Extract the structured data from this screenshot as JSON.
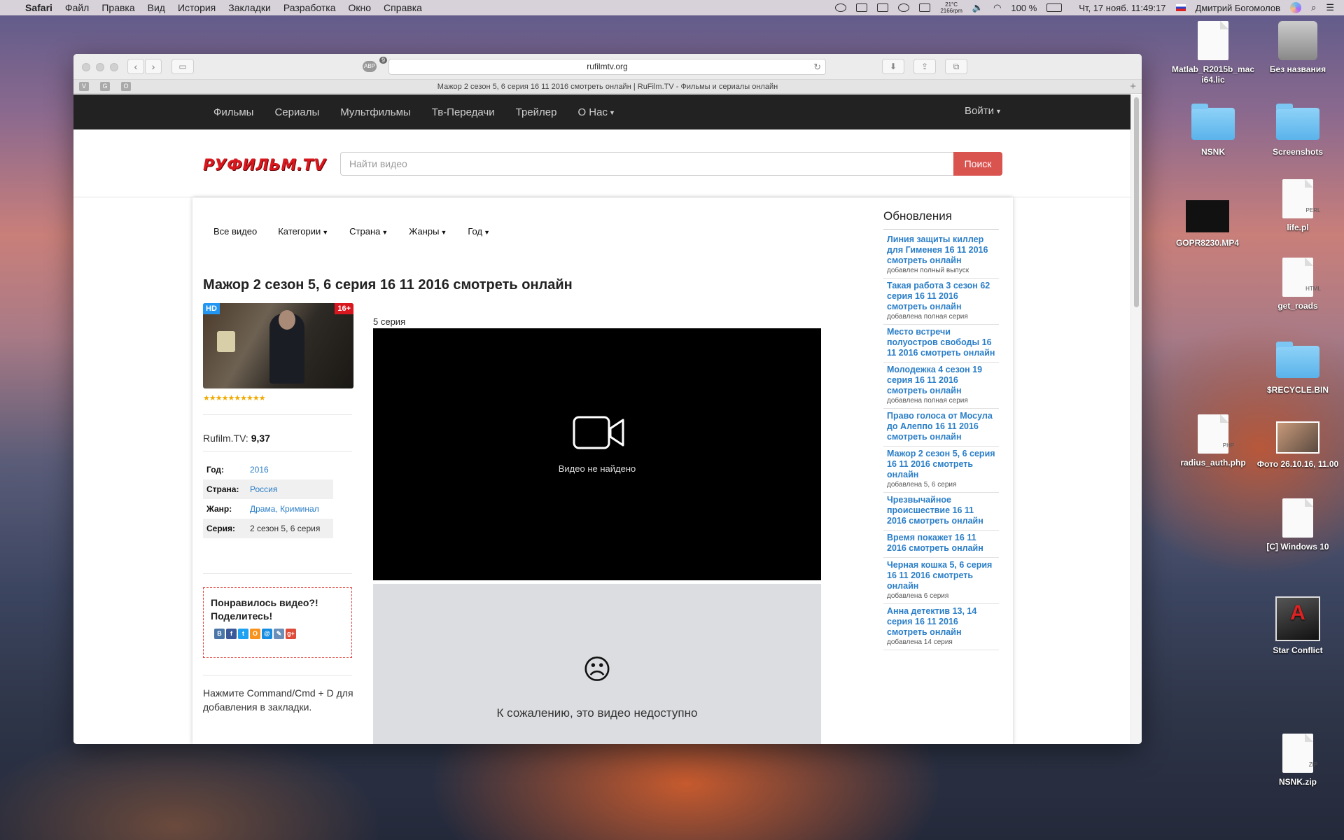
{
  "menubar": {
    "app": "Safari",
    "items": [
      "Файл",
      "Правка",
      "Вид",
      "История",
      "Закладки",
      "Разработка",
      "Окно",
      "Справка"
    ],
    "temp": "21°C",
    "rpm": "2166rpm",
    "battery": "100 %",
    "datetime": "Чт, 17 нояб.  11:49:17",
    "user": "Дмитрий Богомолов"
  },
  "browser": {
    "url": "rufilmtv.org",
    "tab_title": "Мажор 2 сезон 5, 6 серия 16 11 2016 смотреть онлайн | RuFilm.TV - Фильмы и сериалы онлайн",
    "abp_badge": "9",
    "favorites": [
      "V",
      "G",
      "O"
    ]
  },
  "site": {
    "nav": [
      "Фильмы",
      "Сериалы",
      "Мультфильмы",
      "Тв-Передачи",
      "Трейлер",
      "О Нас"
    ],
    "login": "Войти",
    "logo": "РУФИЛЬМ.TV",
    "search_placeholder": "Найти видео",
    "search_button": "Поиск",
    "subnav": [
      "Все видео",
      "Категории",
      "Страна",
      "Жанры",
      "Год"
    ],
    "title": "Мажор 2 сезон 5, 6 серия 16 11 2016 смотреть онлайн",
    "poster_badges": {
      "quality": "HD",
      "age": "16+"
    },
    "stars": "★★★★★★★★★★",
    "rating_label": "Rufilm.TV:",
    "rating_value": "9,37",
    "meta": [
      {
        "key": "Год:",
        "value": "2016"
      },
      {
        "key": "Страна:",
        "value": "Россия"
      },
      {
        "key": "Жанр:",
        "value": "Драма, Криминал"
      },
      {
        "key": "Серия:",
        "value": "2 сезон 5, 6 серия"
      }
    ],
    "share_title": "Понравилось видео?! Поделитесь!",
    "social": [
      "В",
      "f",
      "t",
      "O",
      "@",
      "✎",
      "g+"
    ],
    "bookmark_hint": "Нажмите Command/Cmd + D для добавления в закладки.",
    "episode_label": "5 серия",
    "player_message": "Видео не найдено",
    "sad_face": "☹",
    "unavailable_message": "К сожалению, это видео недоступно",
    "sidebar_title": "Обновления",
    "updates": [
      {
        "title": "Линия защиты киллер для Гименея 16 11 2016 смотреть онлайн",
        "note": "добавлен полный выпуск"
      },
      {
        "title": "Такая работа 3 сезон 62 серия 16 11 2016 смотреть онлайн",
        "note": "добавлена полная серия"
      },
      {
        "title": "Место встречи полуостров свободы 16 11 2016 смотреть онлайн",
        "note": ""
      },
      {
        "title": "Молодежка 4 сезон 19 серия 16 11 2016 смотреть онлайн",
        "note": "добавлена полная серия"
      },
      {
        "title": "Право голоса от Мосула до Алеппо 16 11 2016 смотреть онлайн",
        "note": ""
      },
      {
        "title": "Мажор 2 сезон 5, 6 серия 16 11 2016 смотреть онлайн",
        "note": "добавлена 5, 6 серия"
      },
      {
        "title": "Чрезвычайное происшествие 16 11 2016 смотреть онлайн",
        "note": ""
      },
      {
        "title": "Время покажет 16 11 2016 смотреть онлайн",
        "note": ""
      },
      {
        "title": "Черная кошка 5, 6 серия 16 11 2016 смотреть онлайн",
        "note": "добавлена 6 серия"
      },
      {
        "title": "Анна детектив 13, 14 серия 16 11 2016 смотреть онлайн",
        "note": "добавлена 14 серия"
      }
    ]
  },
  "desktop": [
    {
      "name": "Matlab_R2015b_maci64.lic",
      "kind": "document"
    },
    {
      "name": "Без названия",
      "kind": "disk"
    },
    {
      "name": "NSNK",
      "kind": "folder"
    },
    {
      "name": "Screenshots",
      "kind": "folder"
    },
    {
      "name": "GOPR8230.MP4",
      "kind": "video"
    },
    {
      "name": "life.pl",
      "kind": "document",
      "label": "PERL"
    },
    {
      "name": "get_roads",
      "kind": "document",
      "label": "HTML"
    },
    {
      "name": "$RECYCLE.BIN",
      "kind": "folder"
    },
    {
      "name": "radius_auth.php",
      "kind": "document",
      "label": "PHP"
    },
    {
      "name": "Фото 26.10.16, 11.00",
      "kind": "photo"
    },
    {
      "name": "[C] Windows 10",
      "kind": "document"
    },
    {
      "name": "Star Conflict",
      "kind": "app"
    },
    {
      "name": "NSNK.zip",
      "kind": "document",
      "label": "ZIP"
    }
  ]
}
